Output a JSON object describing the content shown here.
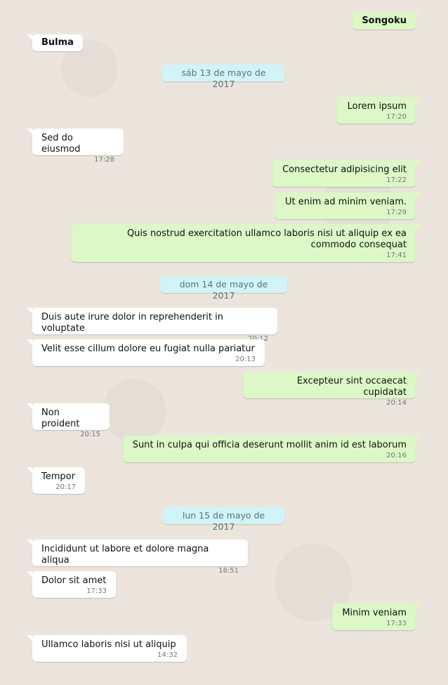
{
  "participants": {
    "me": "Songoku",
    "other": "Bulma"
  },
  "dates": [
    "sáb 13 de mayo de 2017",
    "dom 14 de mayo de 2017",
    "lun 15 de mayo de 2017"
  ],
  "messages": [
    {
      "text": "Lorem ipsum",
      "time": "17:20"
    },
    {
      "text": "Sed do eiusmod",
      "time": "17:28"
    },
    {
      "text": "Consectetur adipisicing elit",
      "time": "17:22"
    },
    {
      "text": "Ut enim ad minim veniam.",
      "time": "17:29"
    },
    {
      "text": "Quis nostrud exercitation ullamco laboris nisi ut aliquip ex ea commodo consequat",
      "time": "17:41"
    },
    {
      "text": "Duis aute irure dolor in reprehenderit in voluptate",
      "time": "20:12"
    },
    {
      "text": "Velit esse cillum dolore eu fugiat nulla pariatur",
      "time": "20:13"
    },
    {
      "text": "Excepteur sint occaecat cupidatat",
      "time": "20:14"
    },
    {
      "text": "Non proident",
      "time": "20:15"
    },
    {
      "text": "Sunt in culpa qui officia deserunt mollit anim id est laborum",
      "time": "20:16"
    },
    {
      "text": "Tempor",
      "time": "20:17"
    },
    {
      "text": "Incididunt ut labore et dolore magna aliqua",
      "time": "16:51"
    },
    {
      "text": "Dolor sit amet",
      "time": "17:33"
    },
    {
      "text": "Minim veniam",
      "time": "17:33"
    },
    {
      "text": "Ullamco laboris nisi ut aliquip",
      "time": "14:32"
    }
  ],
  "colors": {
    "background": "#ece5dd",
    "outgoing": "#dcf8c6",
    "incoming": "#ffffff",
    "date_badge": "#d1f4f8"
  }
}
